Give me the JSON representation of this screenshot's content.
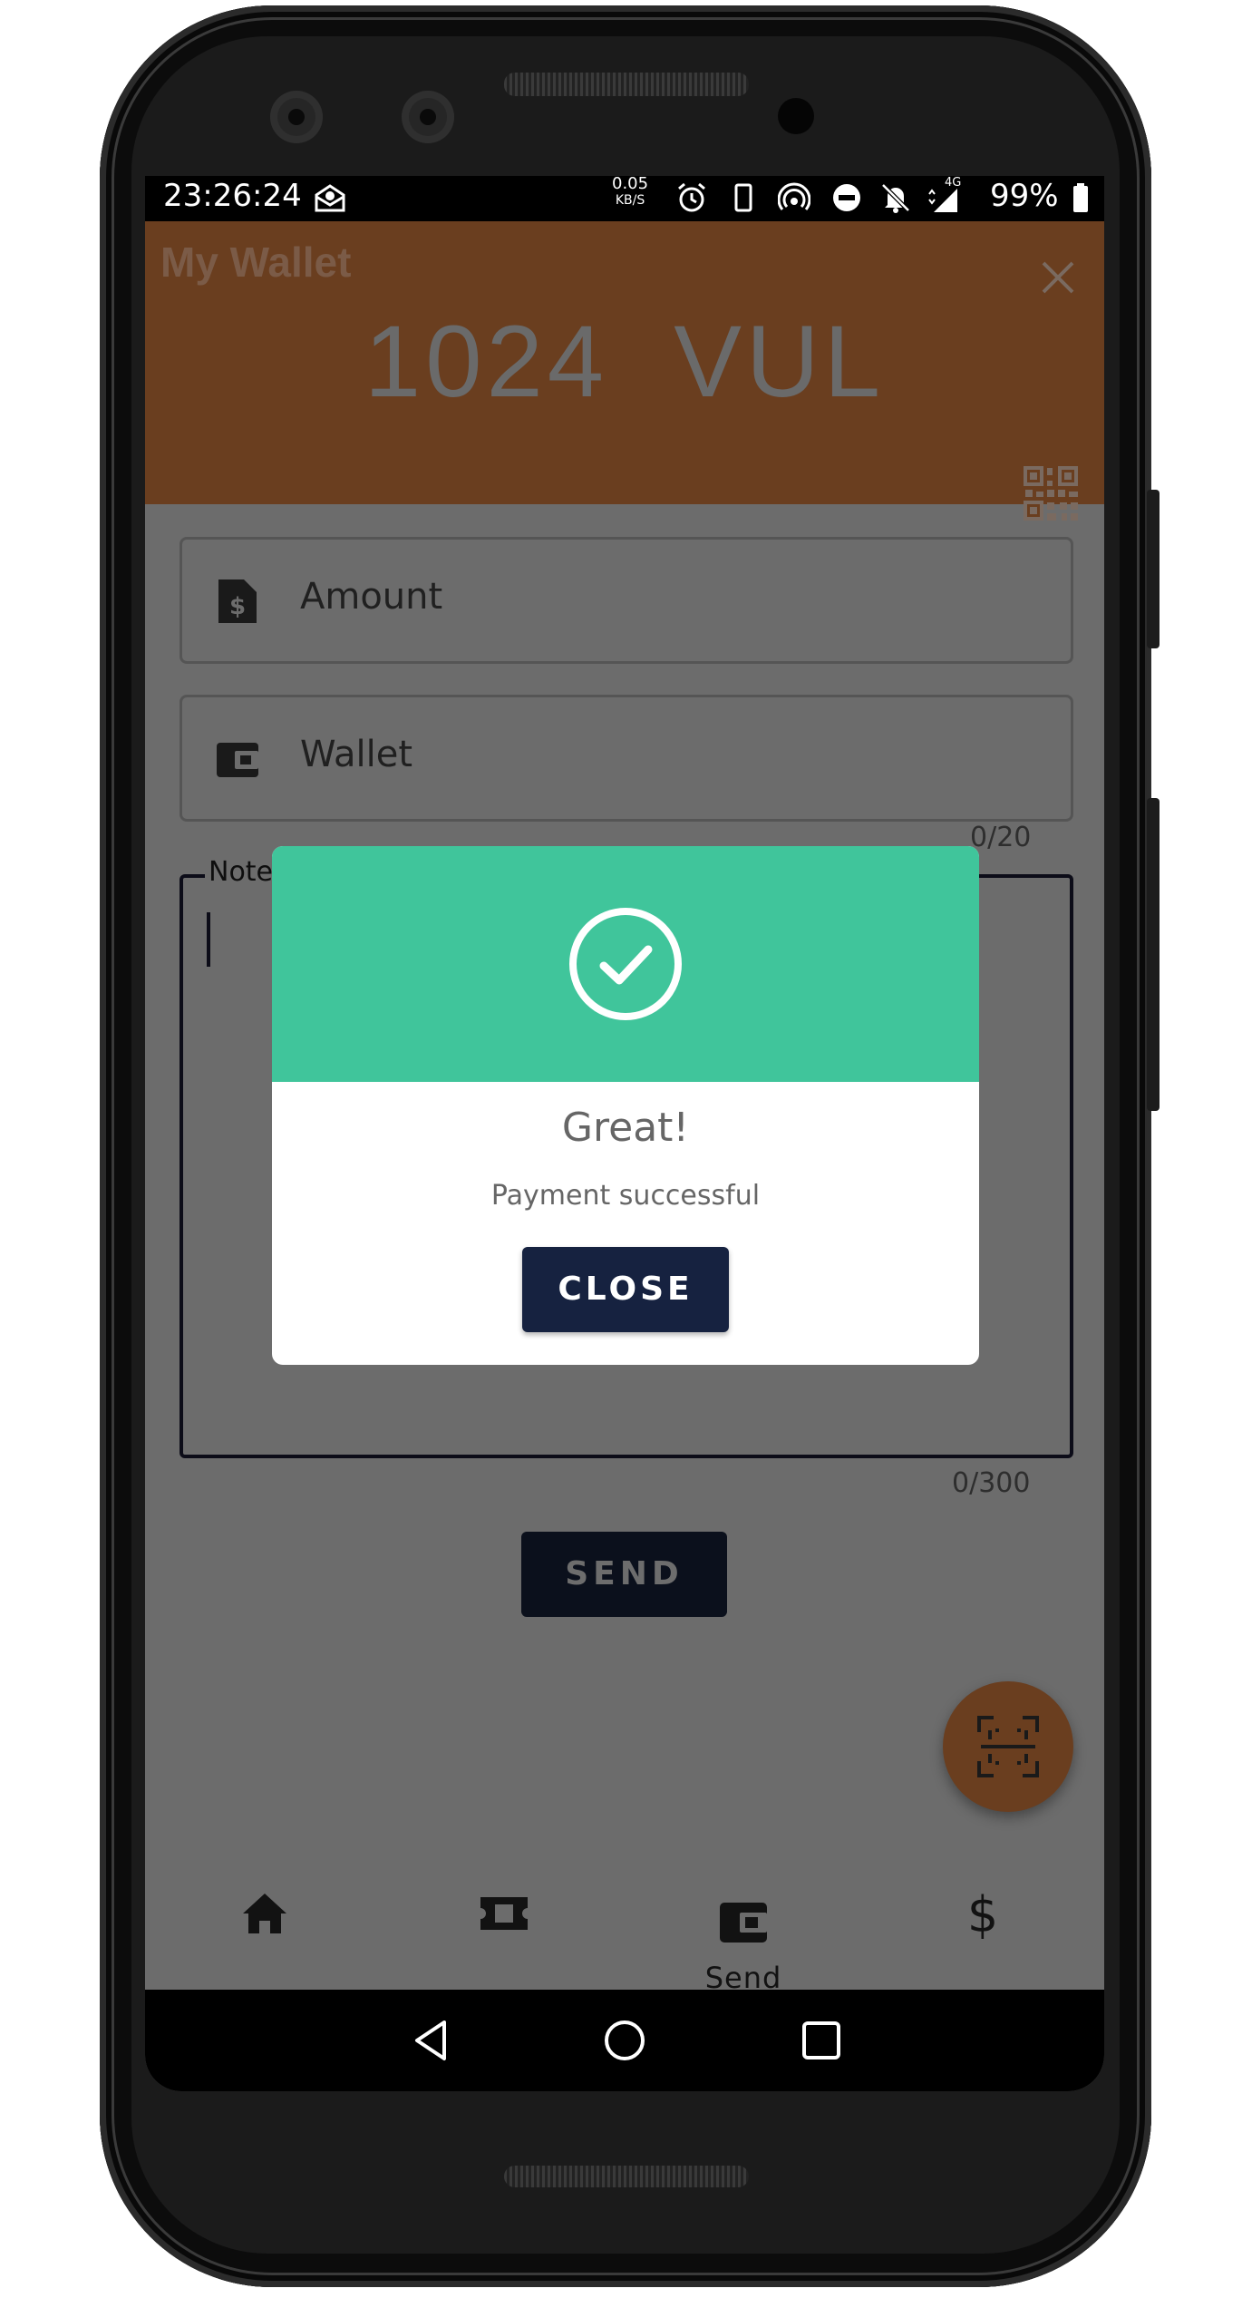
{
  "status_bar": {
    "time": "23:26:24",
    "net_speed_value": "0.05",
    "net_speed_unit": "KB/S",
    "network_label": "4G",
    "battery_percent": "99%"
  },
  "header": {
    "title": "My Wallet",
    "balance": "1024  VUL"
  },
  "form": {
    "amount_placeholder": "Amount",
    "wallet_placeholder": "Wallet",
    "wallet_counter": "0/20",
    "note_label": "Note",
    "note_value": "",
    "note_counter": "0/300",
    "send_label": "SEND"
  },
  "bottom_nav": {
    "items": [
      {
        "icon": "home-icon",
        "label": ""
      },
      {
        "icon": "ticket-icon",
        "label": ""
      },
      {
        "icon": "wallet-icon",
        "label": "Send"
      },
      {
        "icon": "dollar-icon",
        "label": ""
      }
    ]
  },
  "dialog": {
    "icon": "check-circle-icon",
    "title": "Great!",
    "message": "Payment successful",
    "close_label": "CLOSE"
  },
  "colors": {
    "header_bg": "#6a3e1f",
    "dialog_header": "#40c59b",
    "button_bg": "#162240",
    "overlay_bg": "#6c6c6c"
  }
}
